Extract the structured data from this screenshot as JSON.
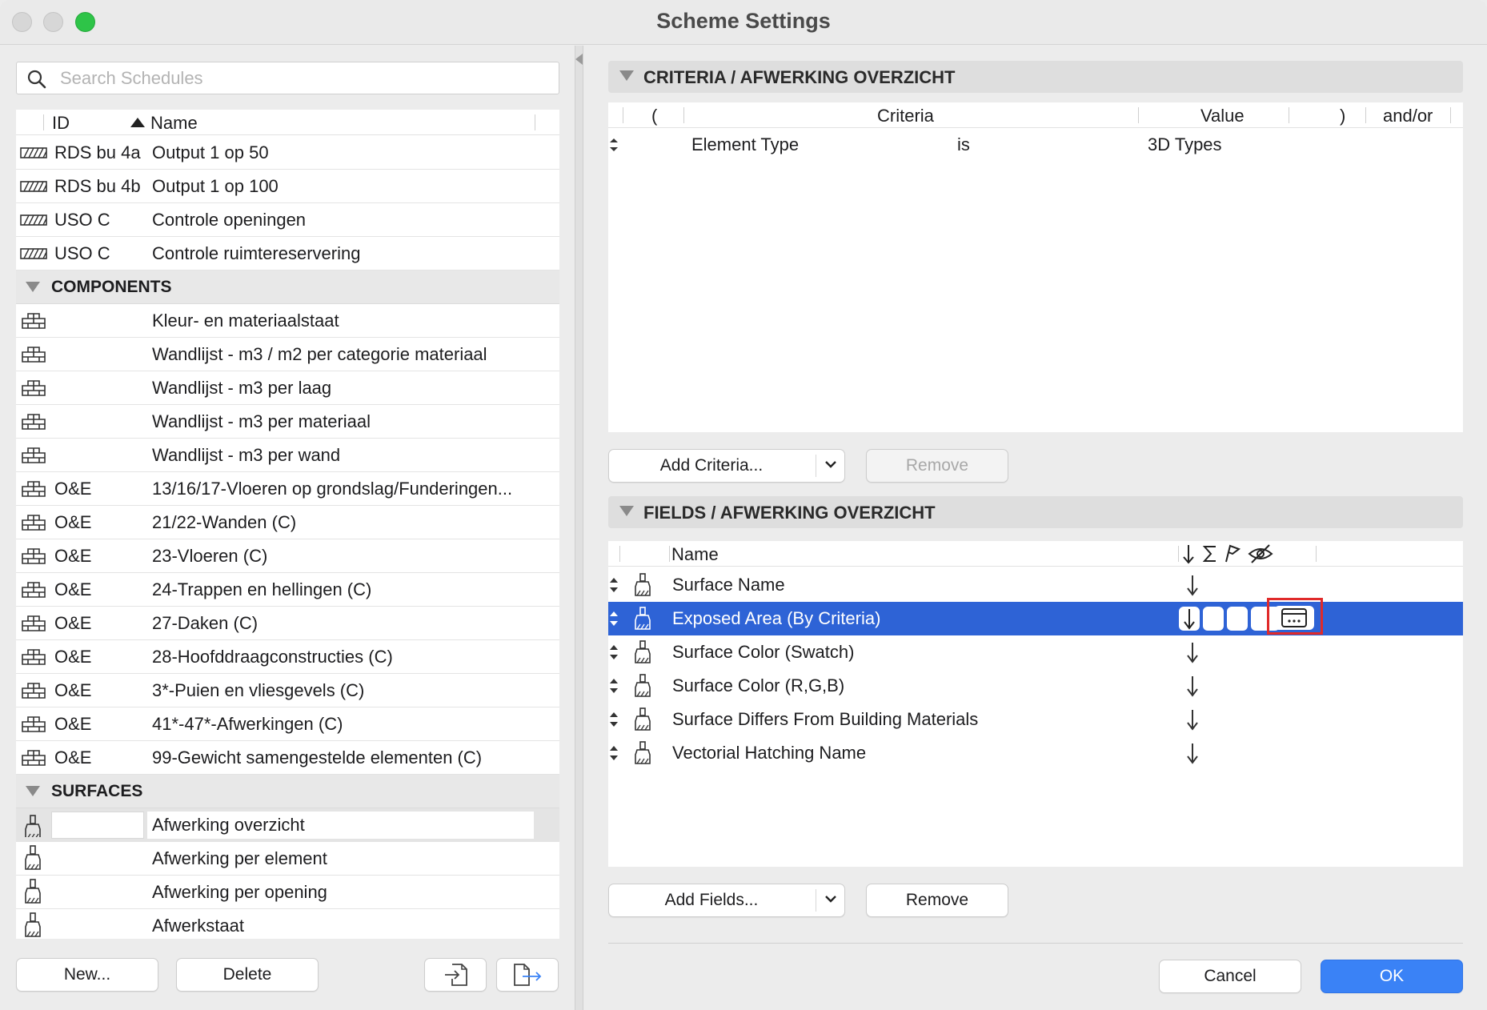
{
  "window": {
    "title": "Scheme Settings",
    "colors": {
      "accent": "#3a82f6",
      "selection": "#2e63d6",
      "highlight": "#e02a2a"
    }
  },
  "search": {
    "placeholder": "Search Schedules",
    "value": ""
  },
  "list": {
    "headers": {
      "id": "ID",
      "name": "Name"
    },
    "top_rows": [
      {
        "id": "RDS bu 4a",
        "name": "Output 1 op  50",
        "icon": "hatch-icon"
      },
      {
        "id": "RDS bu 4b",
        "name": "Output 1 op 100",
        "icon": "hatch-icon"
      },
      {
        "id": "USO C",
        "name": "Controle openingen",
        "icon": "hatch-icon"
      },
      {
        "id": "USO C",
        "name": "Controle ruimtereservering",
        "icon": "hatch-icon"
      }
    ],
    "groups": {
      "components": {
        "label": "COMPONENTS",
        "rows": [
          {
            "id": "",
            "name": "Kleur- en materiaalstaat",
            "icon": "component-icon"
          },
          {
            "id": "",
            "name": "Wandlijst - m3 / m2 per categorie materiaal",
            "icon": "component-icon"
          },
          {
            "id": "",
            "name": "Wandlijst - m3 per laag",
            "icon": "component-icon"
          },
          {
            "id": "",
            "name": "Wandlijst - m3 per materiaal",
            "icon": "component-icon"
          },
          {
            "id": "",
            "name": "Wandlijst - m3 per wand",
            "icon": "component-icon"
          },
          {
            "id": "O&E",
            "name": "13/16/17-Vloeren op grondslag/Funderingen...",
            "icon": "component-icon"
          },
          {
            "id": "O&E",
            "name": "21/22-Wanden (C)",
            "icon": "component-icon"
          },
          {
            "id": "O&E",
            "name": "23-Vloeren (C)",
            "icon": "component-icon"
          },
          {
            "id": "O&E",
            "name": "24-Trappen en hellingen (C)",
            "icon": "component-icon"
          },
          {
            "id": "O&E",
            "name": "27-Daken (C)",
            "icon": "component-icon"
          },
          {
            "id": "O&E",
            "name": "28-Hoofddraagconstructies (C)",
            "icon": "component-icon"
          },
          {
            "id": "O&E",
            "name": "3*-Puien en vliesgevels (C)",
            "icon": "component-icon"
          },
          {
            "id": "O&E",
            "name": "41*-47*-Afwerkingen (C)",
            "icon": "component-icon"
          },
          {
            "id": "O&E",
            "name": "99-Gewicht samengestelde elementen (C)",
            "icon": "component-icon"
          }
        ]
      },
      "surfaces": {
        "label": "SURFACES",
        "rows": [
          {
            "id": "",
            "name": "Afwerking overzicht",
            "icon": "surface-brush-icon",
            "selected": true
          },
          {
            "id": "",
            "name": "Afwerking per element",
            "icon": "surface-brush-icon"
          },
          {
            "id": "",
            "name": "Afwerking per opening",
            "icon": "surface-brush-icon"
          },
          {
            "id": "",
            "name": "Afwerkstaat",
            "icon": "surface-brush-icon"
          }
        ]
      }
    }
  },
  "left_buttons": {
    "new": "New...",
    "delete": "Delete"
  },
  "criteria": {
    "section_label": "CRITERIA /  AFWERKING OVERZICHT",
    "headers": {
      "open_paren": "(",
      "criteria": "Criteria",
      "value": "Value",
      "close_paren": ")",
      "and_or": "and/or"
    },
    "rows": [
      {
        "criteria": "Element Type",
        "operator": "is",
        "value": "3D Types"
      }
    ],
    "add_button": "Add Criteria...",
    "remove_button": "Remove"
  },
  "fields": {
    "section_label": "FIELDS /  AFWERKING OVERZICHT",
    "headers": {
      "name": "Name"
    },
    "rows": [
      {
        "name": "Surface Name"
      },
      {
        "name": "Exposed Area (By Criteria)",
        "selected": true
      },
      {
        "name": "Surface Color (Swatch)"
      },
      {
        "name": "Surface Color (R,G,B)"
      },
      {
        "name": "Surface Differs From Building Materials"
      },
      {
        "name": "Vectorial Hatching Name"
      }
    ],
    "add_button": "Add Fields...",
    "remove_button": "Remove"
  },
  "footer": {
    "cancel": "Cancel",
    "ok": "OK"
  }
}
